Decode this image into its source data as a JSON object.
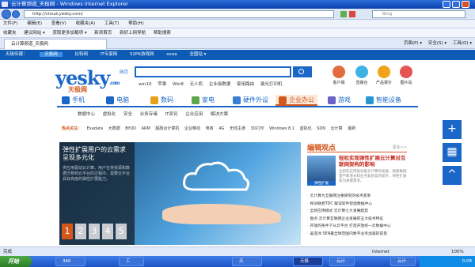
{
  "window": {
    "title": "云计算频道_天极网 - Windows Internet Explorer"
  },
  "address": {
    "url": "http://cloud.yesky.com/",
    "search_placeholder": "Bing"
  },
  "menu": [
    "文件(F)",
    "编辑(E)",
    "查看(V)",
    "收藏夹(A)",
    "工具(T)",
    "帮助(H)"
  ],
  "favorites": {
    "label": "收藏夹",
    "items": [
      "建议网站 ▾",
      "获取更多加载项 ▾",
      "新浪首页",
      "新好上网导航",
      "帮助搜索"
    ]
  },
  "tab": {
    "label": "云计算频道_天极网"
  },
  "ie_tools": [
    "页面(P) ▾",
    "安全(S) ▾",
    "工具(O) ▾"
  ],
  "site_nav": {
    "items": [
      "天极传媒：",
      "天极网",
      "比特网",
      "IT专家网",
      "52PK游戏网",
      "ovoa",
      "全国站 ▾"
    ],
    "active": "天极网"
  },
  "logo": {
    "main": "yesky",
    "sub": "天极网",
    "com": ".com"
  },
  "search": {
    "option": "网页",
    "hot_words": [
      "win10",
      "苹果",
      "Win8",
      "无人机",
      "企业级数据",
      "家用路由",
      "激光打印机"
    ]
  },
  "apps": [
    {
      "label": "客户端",
      "color": "#e36b3d"
    },
    {
      "label": "直播台",
      "color": "#3cb2e5"
    },
    {
      "label": "产品报价",
      "color": "#f0a21a"
    },
    {
      "label": "图片站",
      "color": "#e75454"
    }
  ],
  "categories": [
    {
      "label": "手机",
      "color": "#1a67c7"
    },
    {
      "label": "电脑",
      "color": "#1a67c7"
    },
    {
      "label": "数码",
      "color": "#e6a11b"
    },
    {
      "label": "家电",
      "color": "#5aa74e"
    },
    {
      "label": "硬件外设",
      "color": "#3a7ed1"
    },
    {
      "label": "企业办公",
      "color": "#d4571b"
    },
    {
      "label": "游戏",
      "color": "#6b62c8"
    },
    {
      "label": "智能设备",
      "color": "#2a97d4"
    }
  ],
  "active_category": "企业办公",
  "subnav": [
    "数据中心",
    "虚拟化",
    "安全",
    "业务存储",
    "IT资讯",
    "企业应用",
    "解决方案"
  ],
  "hot_tags": {
    "lead": "热点关注：",
    "items": [
      "Exadata",
      "大数据",
      "BYOD",
      "ARM",
      "超融合计算机",
      "企业移动",
      "电商",
      "4G",
      "无线主通",
      "3D打印",
      "Windows 8.1",
      "虚拟化",
      "SDN",
      "云计算",
      "最新"
    ]
  },
  "hero": {
    "heading": "弹性扩展用户的云需求呈现多元化",
    "desc": "供应用驱动云计算，用户在将资源和数据迁移到云平台的过程中，需要云平台具有高度的弹性扩展能力。",
    "pages": [
      "1",
      "2",
      "3",
      "4",
      "5"
    ],
    "active_page": "1"
  },
  "opinion": {
    "header": "编辑观点",
    "more": "更多>>",
    "thumb_label": "弹性扩展",
    "title": "轻松实现弹性扩展云计算对互联网架构的影响",
    "desc": "全新的应用驱动着云计算的发展，随着数据量不断增长和业务复杂度的提升，弹性扩展成为关键需求。",
    "items": [
      "云计算为互联网注重研究的技术变革",
      "探访联想TDC 解读软件智能数据中心",
      "全新应用模式 云计算七大发展趋势",
      "盘点 云计算互联网企业发展的五大技术特征",
      "开放的条件下从云平台 打造开放统一云数据中心",
      "吴亚洲 SEN最全球范围内数字业务加速的前景"
    ]
  },
  "status": {
    "text": "完成",
    "zone": "Internet",
    "zoom": "100%"
  },
  "taskbar": {
    "start": "开始",
    "tasks": [
      "360",
      "工",
      "天",
      "天极",
      "云计",
      "云计"
    ],
    "clock": "0:08"
  }
}
